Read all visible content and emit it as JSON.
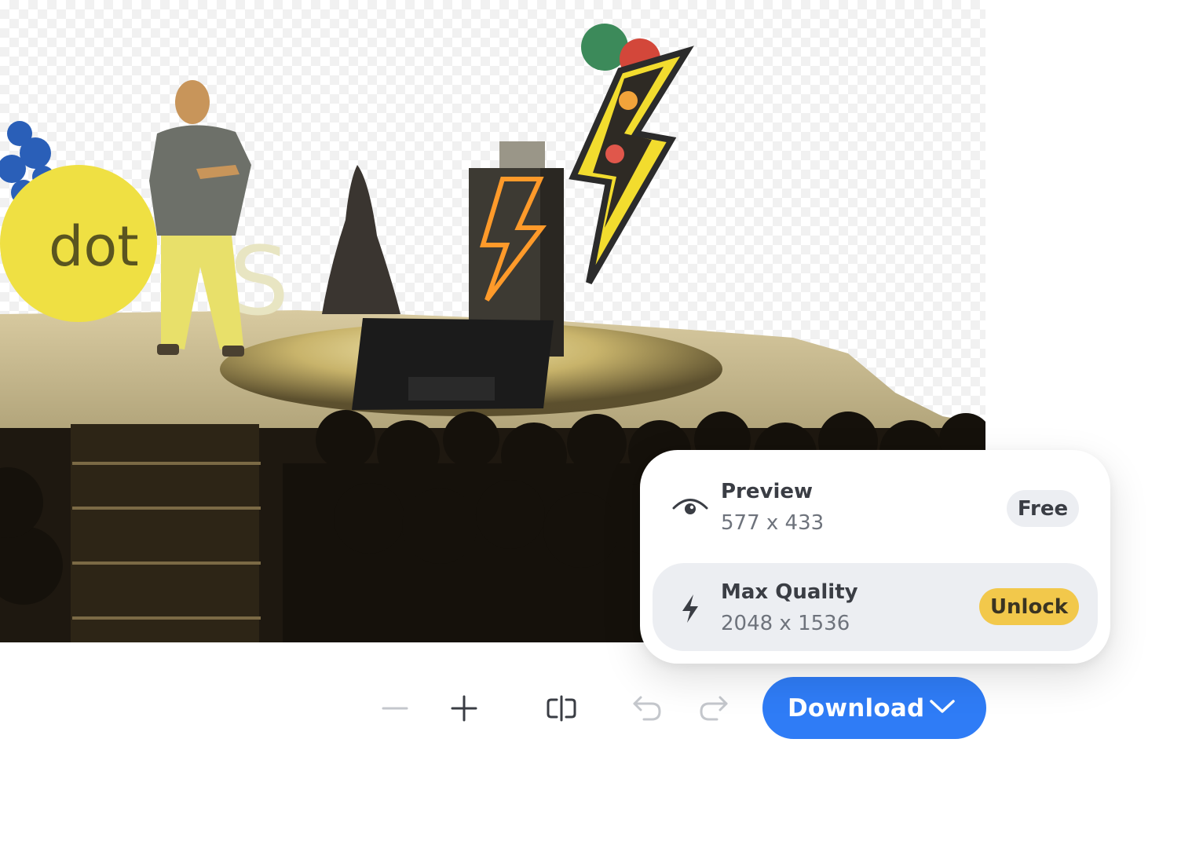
{
  "canvas": {
    "image_subject": "stage-photo",
    "stage_sign_text": "dot",
    "stage_sign_partial": "S"
  },
  "toolbar": {
    "zoom_out_icon": "minus-icon",
    "zoom_in_icon": "plus-icon",
    "compare_icon": "compare-split-icon",
    "undo_icon": "undo-icon",
    "redo_icon": "redo-icon",
    "download_label": "Download",
    "download_chevron_icon": "chevron-down-icon",
    "download_color": "#2f7cf6"
  },
  "download_menu": {
    "options": [
      {
        "icon": "eye-icon",
        "title": "Preview",
        "dimensions": "577 x 433",
        "badge": "Free",
        "badge_color": "#eceef2"
      },
      {
        "icon": "lightning-icon",
        "title": "Max Quality",
        "dimensions": "2048 x 1536",
        "badge": "Unlock",
        "badge_color": "#f2c84b"
      }
    ]
  }
}
